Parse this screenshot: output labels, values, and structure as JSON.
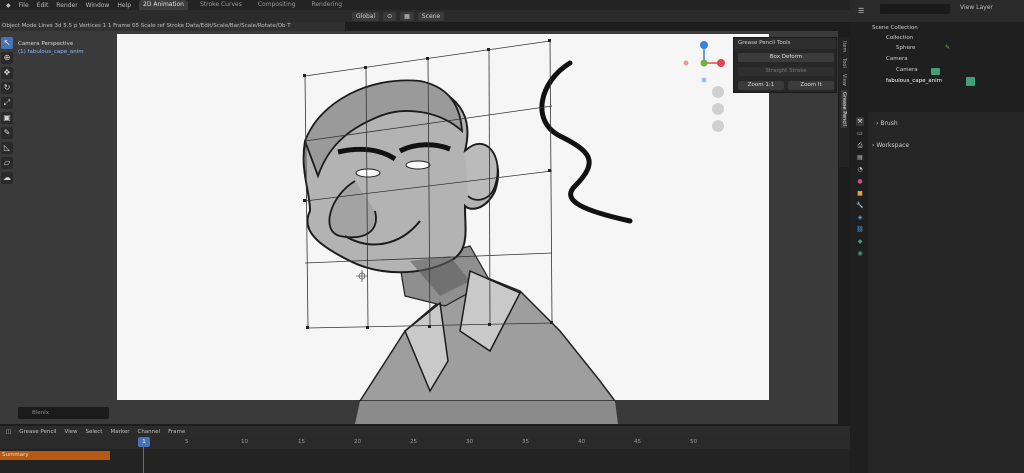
{
  "topbar": {
    "menus": [
      "File",
      "Edit",
      "Render",
      "Window",
      "Help"
    ],
    "tabs": [
      "2D Animation",
      "Stroke Curves",
      "Compositing",
      "Rendering"
    ],
    "active_tab": "2D Animation",
    "right_label": "View Layer"
  },
  "header": {
    "mode_label": "Global",
    "scene_label": "Scene"
  },
  "infobar": {
    "text": "Object Mode    Lines 3d 5.5 p  Vertices 1 1   Frame 05   Scale ref  Stroke Data/Edit/Scale/Bar/Scale/Rotate/Ob  T"
  },
  "viewport": {
    "camera_label": "Camera Perspective",
    "object_label": "(1) fabulous_cape_anim"
  },
  "npanel": {
    "title": "Grease Pencil Tools",
    "buttons": {
      "box_deform": "Box Deform",
      "straight_stroke": "Straight Stroke",
      "zoom_fit": "Zoom 1:1",
      "zoom_in": "Zoom It"
    },
    "tabs": [
      "Item",
      "Tool",
      "View",
      "Grease Pencil"
    ],
    "active_tab": "Grease Pencil"
  },
  "search": {
    "placeholder": "Blenix"
  },
  "timeline": {
    "menus": [
      "Grease Pencil",
      "View",
      "Select",
      "Marker",
      "Channel",
      "Frame"
    ],
    "current_frame": "1",
    "ruler": [
      "1",
      "5",
      "10",
      "15",
      "20",
      "25",
      "30",
      "35",
      "40",
      "45",
      "50"
    ],
    "summary_label": "Summary"
  },
  "outliner": {
    "title": "Scene Collection",
    "rows": [
      {
        "label": "Scene Collection",
        "indent": 0
      },
      {
        "label": "Collection",
        "indent": 1
      },
      {
        "label": "Sphere",
        "indent": 2
      },
      {
        "label": "Camera",
        "indent": 1
      },
      {
        "label": "Camera",
        "indent": 2
      },
      {
        "label": "fabulous_cape_anim",
        "indent": 1
      }
    ]
  },
  "properties": {
    "row1": "Brush",
    "row2": "Workspace"
  },
  "colors": {
    "accent": "#4772b3",
    "summary": "#b45a14",
    "gizmo_x": "#e0454f",
    "gizmo_y": "#6db33f",
    "gizmo_z": "#3d7fe0"
  }
}
